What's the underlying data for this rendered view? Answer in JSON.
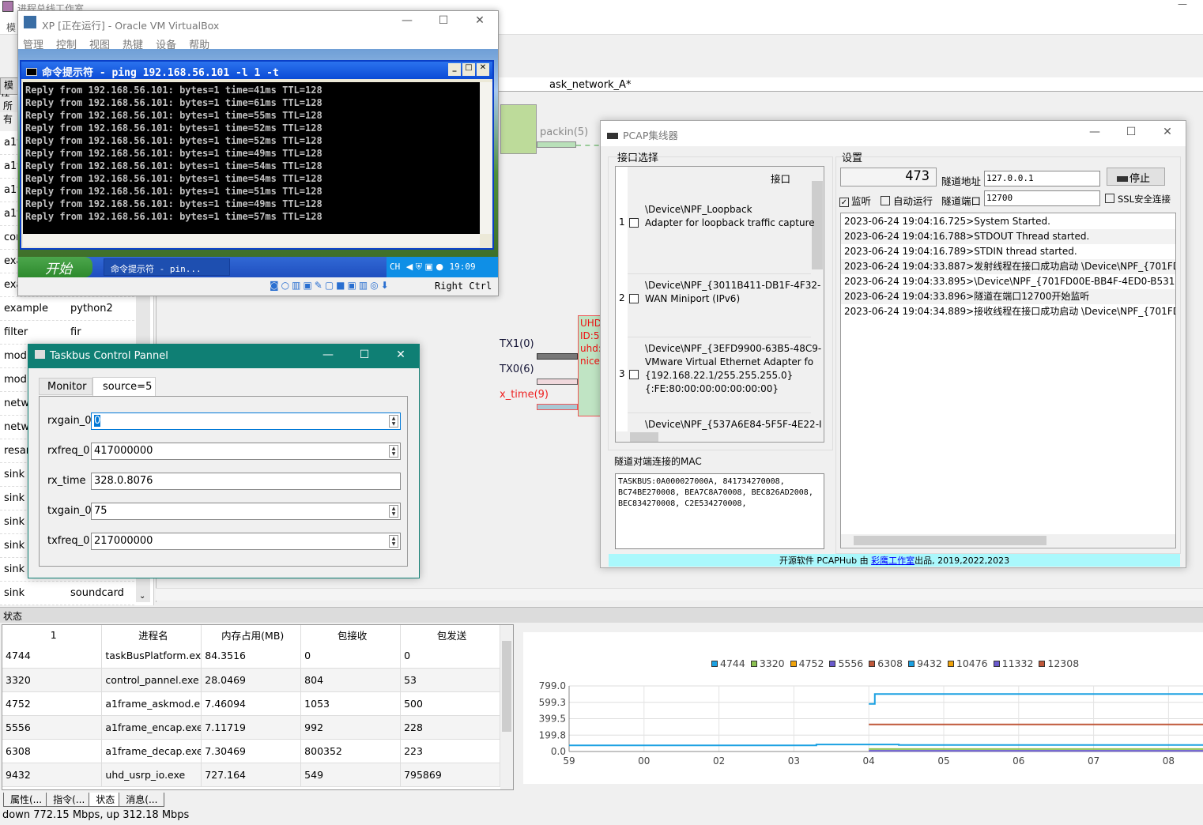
{
  "main_app": {
    "title": "进程总线工作室",
    "menu_first": "模",
    "panel_tab": "模块",
    "panel_header": "所有",
    "module_rows": [
      [
        "a1f",
        ""
      ],
      [
        "a1f",
        ""
      ],
      [
        "a1f",
        ""
      ],
      [
        "a1f",
        ""
      ],
      [
        "cor",
        ""
      ],
      [
        "exa",
        ""
      ],
      [
        "exa",
        ""
      ],
      [
        "example",
        "python2"
      ],
      [
        "filter",
        "fir"
      ],
      [
        "mod",
        ""
      ],
      [
        "mod",
        ""
      ],
      [
        "netw",
        ""
      ],
      [
        "netw",
        ""
      ],
      [
        "resar",
        ""
      ],
      [
        "sink",
        ""
      ],
      [
        "sink",
        ""
      ],
      [
        "sink",
        ""
      ],
      [
        "sink",
        ""
      ],
      [
        "sink",
        ""
      ],
      [
        "sink",
        "soundcard"
      ]
    ],
    "canvas_tab": "ask_network_A*",
    "canvas": {
      "packin": "packin(5)",
      "tx1": "TX1(0)",
      "tx0": "TX0(6)",
      "rx_time": "x_time(9)",
      "uhd_lines": [
        "UHD",
        "ID:5",
        "uhd:",
        "nice="
      ]
    },
    "status_header": "状态",
    "table": {
      "headers": [
        "1",
        "进程名",
        "内存占用(MB)",
        "包接收",
        "包发送"
      ],
      "rows": [
        [
          "4744",
          "taskBusPlatform.exe",
          "84.3516",
          "0",
          "0"
        ],
        [
          "3320",
          "control_pannel.exe",
          "28.0469",
          "804",
          "53"
        ],
        [
          "4752",
          "a1frame_askmod.e...",
          "7.46094",
          "1053",
          "500"
        ],
        [
          "5556",
          "a1frame_encap.exe",
          "7.11719",
          "992",
          "228"
        ],
        [
          "6308",
          "a1frame_decap.exe",
          "7.30469",
          "800352",
          "223"
        ],
        [
          "9432",
          "uhd_usrp_io.exe",
          "727.164",
          "549",
          "795869"
        ]
      ]
    },
    "bottom_tabs": [
      "属性(...",
      "指令(...",
      "状态",
      "消息(..."
    ],
    "statusbar": "down 772.15 Mbps, up 312.18 Mbps"
  },
  "vbox": {
    "title": "XP [正在运行] - Oracle VM VirtualBox",
    "menu": [
      "管理",
      "控制",
      "视图",
      "热键",
      "设备",
      "帮助"
    ],
    "cmd_title": "命令提示符 - ping 192.168.56.101 -l 1 -t",
    "ping_lines": [
      "Reply from 192.168.56.101: bytes=1 time=41ms TTL=128",
      "Reply from 192.168.56.101: bytes=1 time=61ms TTL=128",
      "Reply from 192.168.56.101: bytes=1 time=55ms TTL=128",
      "Reply from 192.168.56.101: bytes=1 time=52ms TTL=128",
      "Reply from 192.168.56.101: bytes=1 time=52ms TTL=128",
      "Reply from 192.168.56.101: bytes=1 time=49ms TTL=128",
      "Reply from 192.168.56.101: bytes=1 time=54ms TTL=128",
      "Reply from 192.168.56.101: bytes=1 time=54ms TTL=128",
      "Reply from 192.168.56.101: bytes=1 time=51ms TTL=128",
      "Reply from 192.168.56.101: bytes=1 time=49ms TTL=128",
      "Reply from 192.168.56.101: bytes=1 time=57ms TTL=128"
    ],
    "start": "开始",
    "task": "命令提示符 - pin...",
    "lang": "CH",
    "clock": "19:09",
    "host_key": "Right Ctrl"
  },
  "control_panel": {
    "title": "Taskbus Control Pannel",
    "tabs": [
      "Monitor",
      "source=5"
    ],
    "fields": [
      {
        "label": "rxgain_0",
        "value": "0",
        "spin": true
      },
      {
        "label": "rxfreq_0",
        "value": "417000000",
        "spin": true
      },
      {
        "label": "rx_time",
        "value": "328.0.8076",
        "spin": false
      },
      {
        "label": "txgain_0",
        "value": "75",
        "spin": true
      },
      {
        "label": "txfreq_0",
        "value": "217000000",
        "spin": true
      }
    ]
  },
  "pcap": {
    "title": "PCAP集线器",
    "iface_group": "接口选择",
    "settings_group": "设置",
    "iface_header": "接口",
    "ifaces": [
      {
        "n": "1",
        "lines": [
          "\\Device\\NPF_Loopback",
          "Adapter for loopback traffic capture"
        ]
      },
      {
        "n": "2",
        "lines": [
          "\\Device\\NPF_{3011B411-DB1F-4F32-",
          "WAN Miniport (IPv6)"
        ]
      },
      {
        "n": "3",
        "lines": [
          "\\Device\\NPF_{3EFD9900-63B5-48C9-",
          "VMware Virtual Ethernet Adapter fo",
          "{192.168.22.1/255.255.255.0}",
          "{:FE:80:00:00:00:00:00:00}"
        ]
      },
      {
        "n": "",
        "lines": [
          "\\Device\\NPF_{537A6E84-5F5F-4E22-I"
        ]
      }
    ],
    "counter": "473",
    "tunnel_addr_label": "隧道地址",
    "tunnel_addr": "127.0.0.1",
    "stop": "停止",
    "listen": "监听",
    "listen_checked": true,
    "autorun": "自动运行",
    "tunnel_port_label": "隧道端口",
    "tunnel_port": "12700",
    "ssl": "SSL安全连接",
    "log": [
      "2023-06-24 19:04:16.725>System Started.",
      "2023-06-24 19:04:16.788>STDOUT Thread started.",
      "2023-06-24 19:04:16.789>STDIN thread started.",
      "2023-06-24 19:04:33.887>发射线程在接口成功启动 \\Device\\NPF_{701FD00I",
      "2023-06-24 19:04:33.895>\\Device\\NPF_{701FD00E-BB4F-4ED0-B531-8DA",
      "2023-06-24 19:04:33.896>隧道在端口12700开始监听",
      "2023-06-24 19:04:34.889>接收线程在接口成功启动 \\Device\\NPF_{701FD00I"
    ],
    "mac_label": "隧道对端连接的MAC",
    "mac_lines": [
      "TASKBUS:0A000027000A, 841734270008,",
      "BC74BE270008, BEA7C8A70008, BEC826AD2008,",
      "BEC834270008, C2E534270008,"
    ],
    "footer_pre": "开源软件 PCAPHub 由 ",
    "footer_link": "彩鹰工作室",
    "footer_post": "出品, 2019,2022,2023"
  },
  "chart_data": {
    "type": "line",
    "xtick_labels": [
      "59",
      "00",
      "02",
      "03",
      "04",
      "05",
      "06",
      "07",
      "08"
    ],
    "yticks": [
      "799.0",
      "599.3",
      "399.5",
      "199.8",
      "0.0"
    ],
    "ylim": [
      0,
      799
    ],
    "grid": true,
    "legend": "top",
    "legend_entries": [
      {
        "name": "4744",
        "color": "#1ba1e2"
      },
      {
        "name": "3320",
        "color": "#8cc152"
      },
      {
        "name": "4752",
        "color": "#f0a30a"
      },
      {
        "name": "5556",
        "color": "#6a5acd"
      },
      {
        "name": "6308",
        "color": "#c0583a"
      },
      {
        "name": "9432",
        "color": "#1ba1e2"
      },
      {
        "name": "10476",
        "color": "#f0a30a"
      },
      {
        "name": "11332",
        "color": "#6a5acd"
      },
      {
        "name": "12308",
        "color": "#c0583a"
      }
    ],
    "series": [
      {
        "color": "#1ba1e2",
        "points": [
          [
            0,
            75
          ],
          [
            3.3,
            75
          ],
          [
            3.3,
            85
          ],
          [
            4.4,
            85
          ],
          [
            4.4,
            80
          ],
          [
            8.5,
            80
          ]
        ]
      },
      {
        "color": "#1ba1e2",
        "points": [
          [
            4,
            580
          ],
          [
            4.08,
            580
          ],
          [
            4.08,
            700
          ],
          [
            8.5,
            700
          ]
        ]
      },
      {
        "color": "#c0583a",
        "points": [
          [
            4,
            330
          ],
          [
            8.5,
            330
          ]
        ]
      },
      {
        "color": "#8cc152",
        "points": [
          [
            4,
            30
          ],
          [
            8.5,
            30
          ]
        ]
      },
      {
        "color": "#6a5acd",
        "points": [
          [
            4,
            8
          ],
          [
            8.5,
            8
          ]
        ]
      }
    ]
  }
}
